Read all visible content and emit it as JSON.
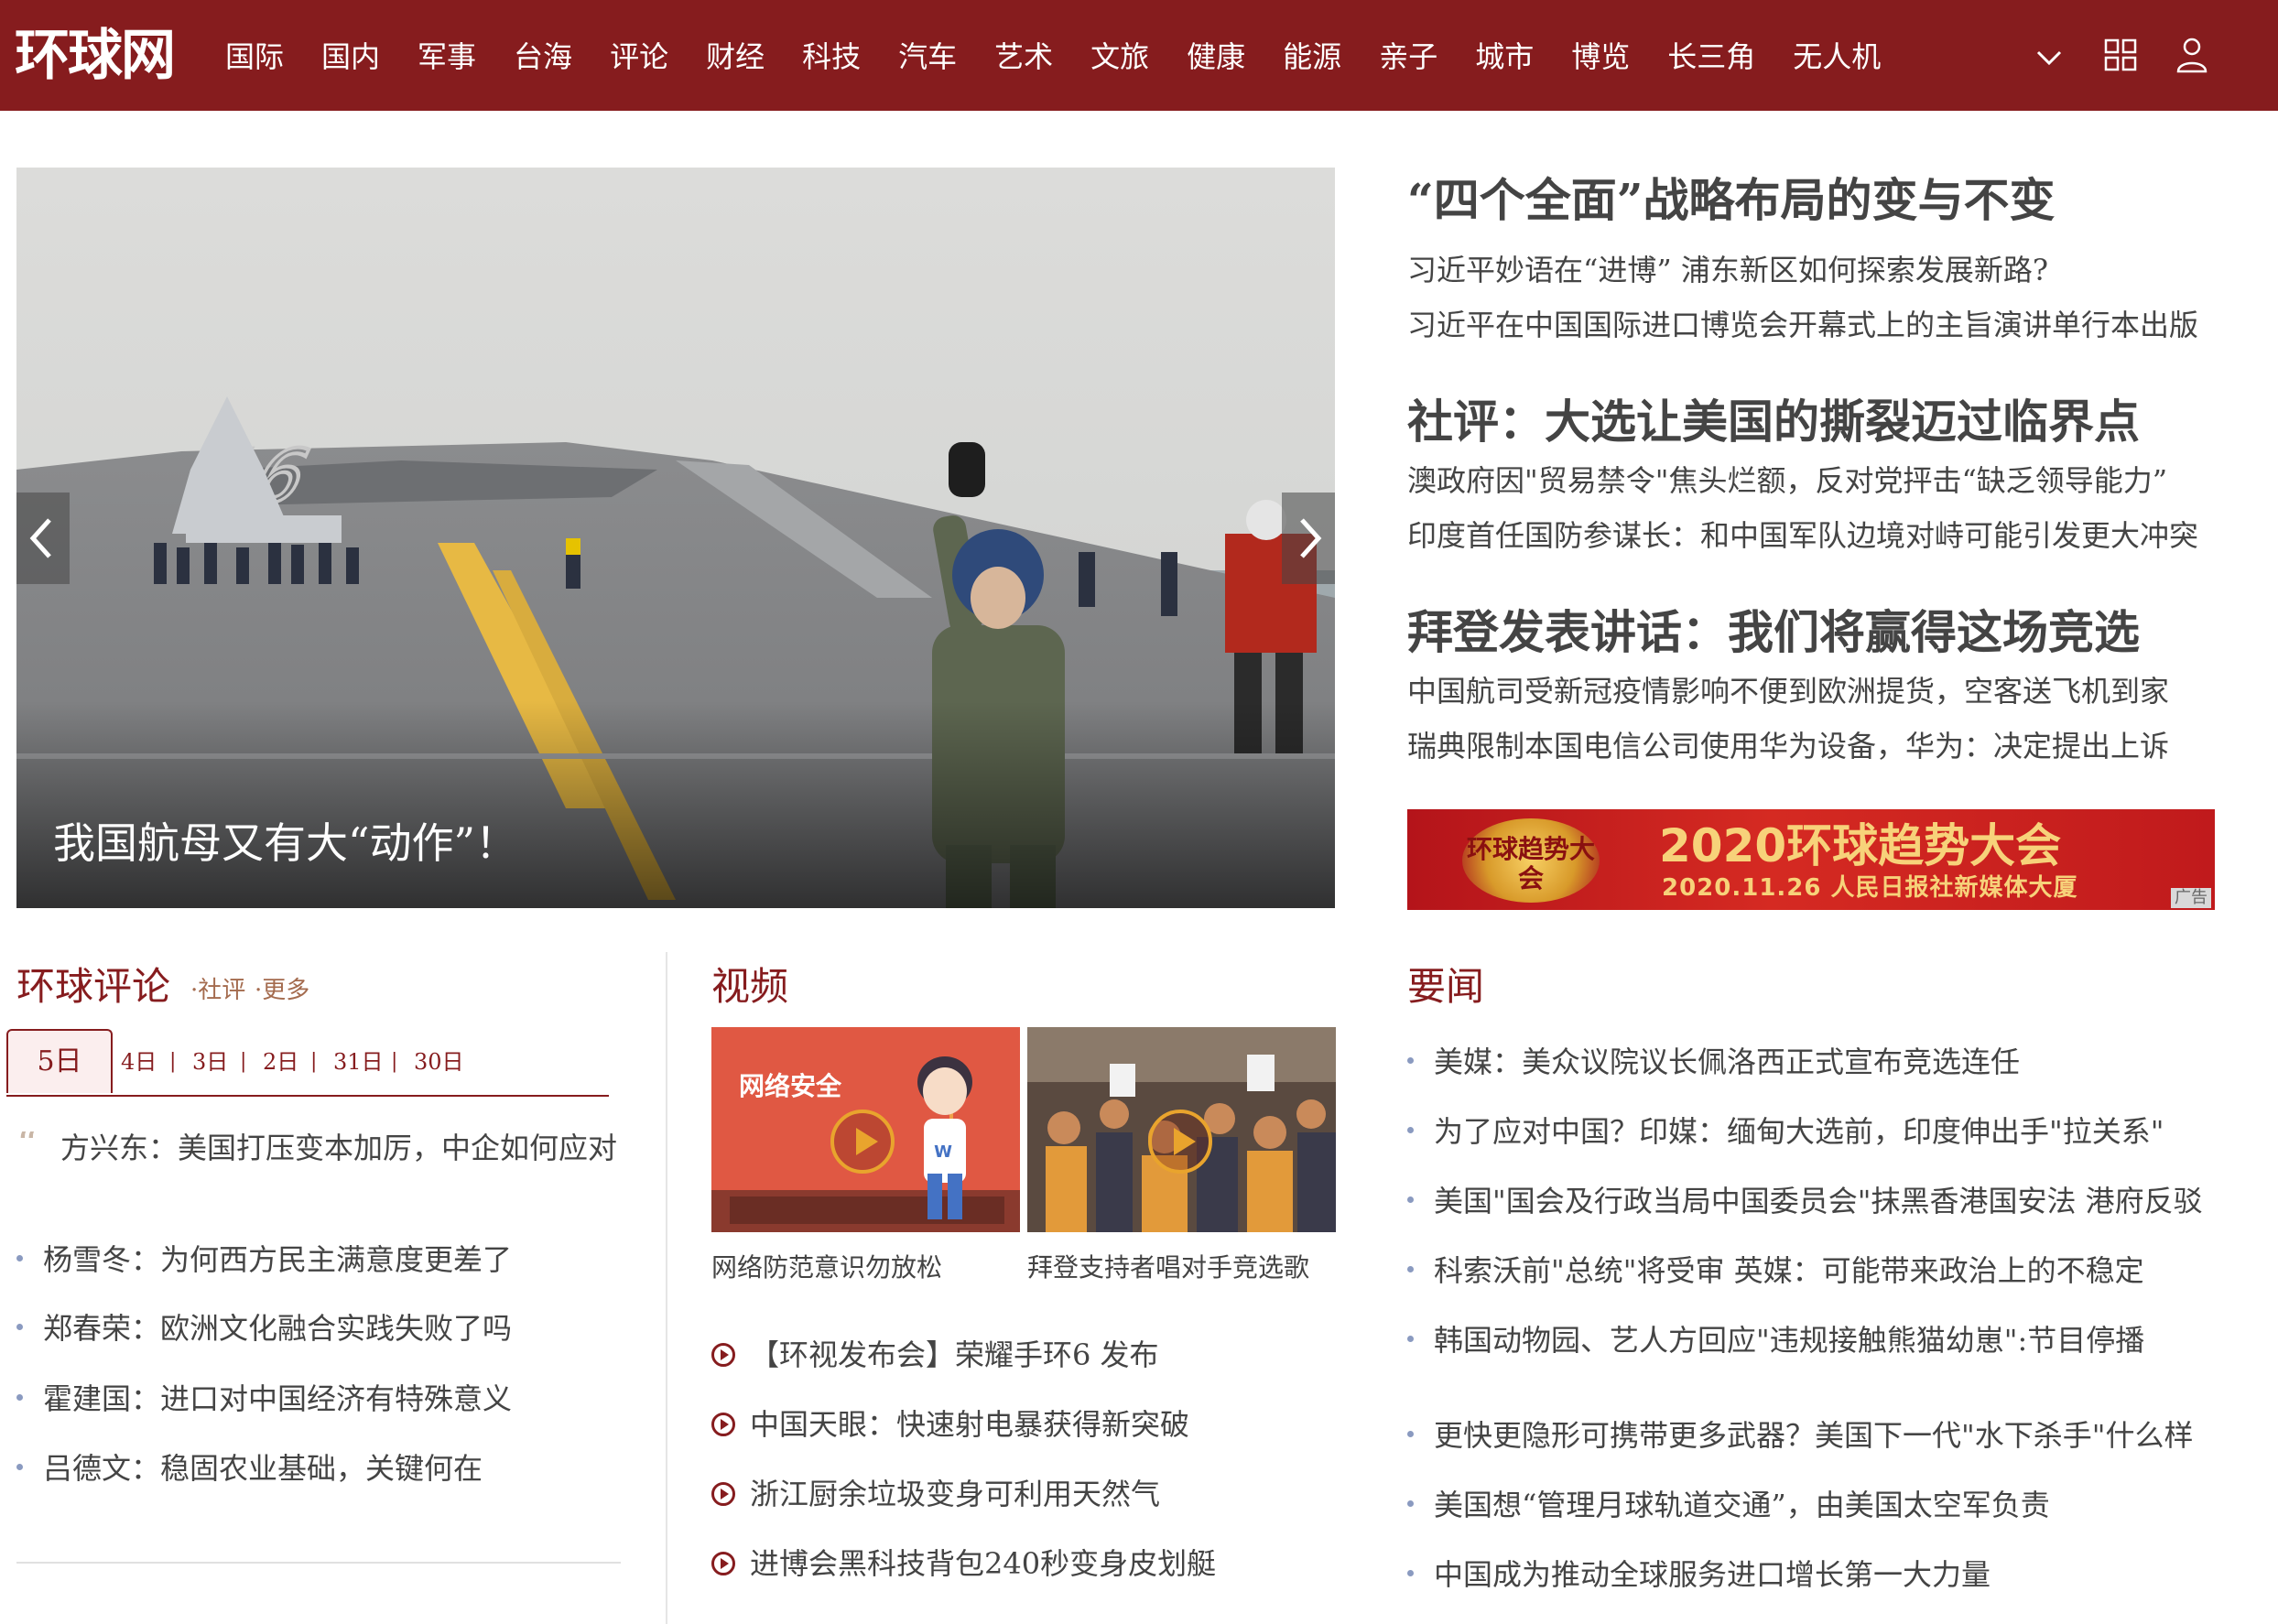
{
  "header": {
    "logo": "环球网",
    "nav": [
      "国际",
      "国内",
      "军事",
      "台海",
      "评论",
      "财经",
      "科技",
      "汽车",
      "艺术",
      "文旅",
      "健康",
      "能源",
      "亲子",
      "城市",
      "博览",
      "长三角",
      "无人机"
    ],
    "more_icon": "chevron-down-icon",
    "apps_icon": "grid-icon",
    "account_icon": "user-icon",
    "colors": {
      "brand": "#861c1e"
    }
  },
  "hero": {
    "caption": "我国航母又有大“动作”！",
    "slide_count": 5,
    "active_slide": 2
  },
  "headlines": [
    {
      "title": "“四个全面”战略布局的变与不变",
      "subs": [
        "习近平妙语在“进博” 浦东新区如何探索发展新路?",
        "习近平在中国国际进口博览会开幕式上的主旨演讲单行本出版"
      ]
    },
    {
      "title": "社评：大选让美国的撕裂迈过临界点",
      "subs": [
        "澳政府因\"贸易禁令\"焦头烂额，反对党抨击“缺乏领导能力”",
        "印度首任国防参谋长：和中国军队边境对峙可能引发更大冲突"
      ]
    },
    {
      "title": "拜登发表讲话：我们将赢得这场竞选",
      "subs": [
        "中国航司受新冠疫情影响不便到欧洲提货，空客送飞机到家",
        "瑞典限制本国电信公司使用华为设备，华为：决定提出上诉"
      ]
    }
  ],
  "ad": {
    "logo_text": "环球趋势大会",
    "title": "2020环球趋势大会",
    "subtitle": "2020.11.26  人民日报社新媒体大厦",
    "tag": "广告"
  },
  "comment": {
    "title": "环球评论",
    "link1": "社评",
    "link2": "更多",
    "date_active": "5日",
    "dates": [
      "4日",
      "3日",
      "2日",
      "31日",
      "30日"
    ],
    "featured": "方兴东：美国打压变本加厉，中企如何应对",
    "items": [
      "杨雪冬：为何西方民主满意度更差了",
      "郑春荣：欧洲文化融合实践失败了吗",
      "霍建国：进口对中国经济有特殊意义",
      "吕德文：稳固农业基础，关键何在"
    ]
  },
  "video": {
    "title": "视频",
    "thumb1_text": "网络安全",
    "thumb1_badge": "W",
    "thumb1_caption": "网络防范意识勿放松",
    "thumb2_caption": "拜登支持者唱对手竞选歌",
    "items": [
      "【环视发布会】荣耀手环6 发布",
      "中国天眼：快速射电暴获得新突破",
      "浙江厨余垃圾变身可利用天然气",
      "进博会黑科技背包240秒变身皮划艇"
    ]
  },
  "news": {
    "title": "要闻",
    "group1": [
      "美媒：美众议院议长佩洛西正式宣布竞选连任",
      "为了应对中国？印媒：缅甸大选前，印度伸出手\"拉关系\"",
      "美国\"国会及行政当局中国委员会\"抹黑香港国安法 港府反驳",
      "科索沃前\"总统\"将受审 英媒：可能带来政治上的不稳定",
      "韩国动物园、艺人方回应\"违规接触熊猫幼崽\":节目停播"
    ],
    "group2": [
      "更快更隐形可携带更多武器？美国下一代\"水下杀手\"什么样",
      "美国想“管理月球轨道交通”，由美国太空军负责",
      "中国成为推动全球服务进口增长第一大力量"
    ]
  }
}
